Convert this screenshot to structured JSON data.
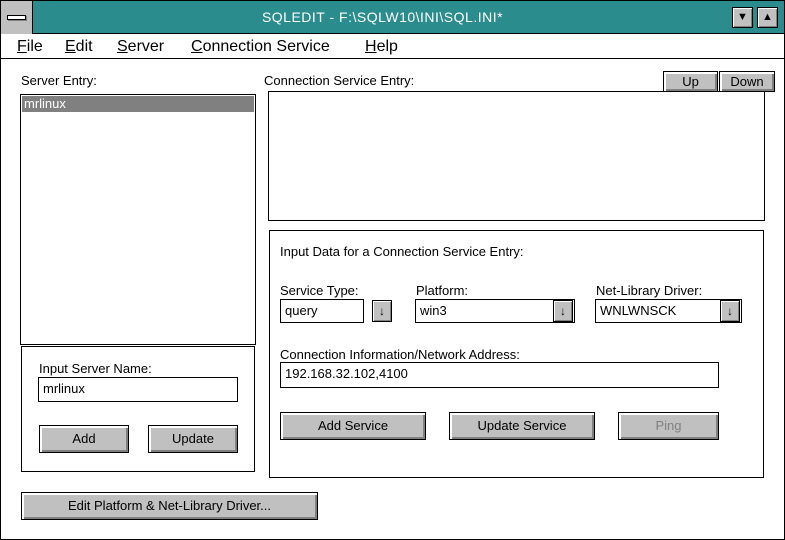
{
  "window": {
    "title": "SQLEDIT - F:\\SQLW10\\INI\\SQL.INI*",
    "sys_icon": "system-menu-icon",
    "minimize_icon": "▼",
    "maximize_icon": "▲"
  },
  "menu": {
    "file": {
      "u": "F",
      "rest": "ile"
    },
    "edit": {
      "u": "E",
      "rest": "dit"
    },
    "server": {
      "u": "S",
      "rest": "erver"
    },
    "connection": {
      "u": "C",
      "rest": "onnection Service"
    },
    "help": {
      "u": "H",
      "rest": "elp"
    }
  },
  "server_entry": {
    "label": "Server Entry:",
    "items": [
      "mrlinux"
    ]
  },
  "connection_entry": {
    "label": "Connection Service Entry:",
    "up_label": "Up",
    "down_label": "Down"
  },
  "input_server": {
    "label": "Input Server Name:",
    "value": "mrlinux",
    "add_label": "Add",
    "update_label": "Update"
  },
  "input_data": {
    "heading": "Input Data for a Connection Service Entry:",
    "service_type_label": "Service Type:",
    "service_type_value": "query",
    "platform_label": "Platform:",
    "platform_value": "win3",
    "netlib_label": "Net-Library Driver:",
    "netlib_value": "WNLWNSCK",
    "conn_info_label": "Connection Information/Network Address:",
    "conn_info_value": "192.168.32.102,4100",
    "dropdown_icon": "↓",
    "add_service_label": "Add Service",
    "update_service_label": "Update Service",
    "ping_label": "Ping"
  },
  "footer": {
    "edit_platform_label": "Edit Platform & Net-Library Driver..."
  },
  "colors": {
    "titlebar": "#2a8c8c",
    "button_face": "#c0c0c0",
    "selection": "#808080"
  }
}
